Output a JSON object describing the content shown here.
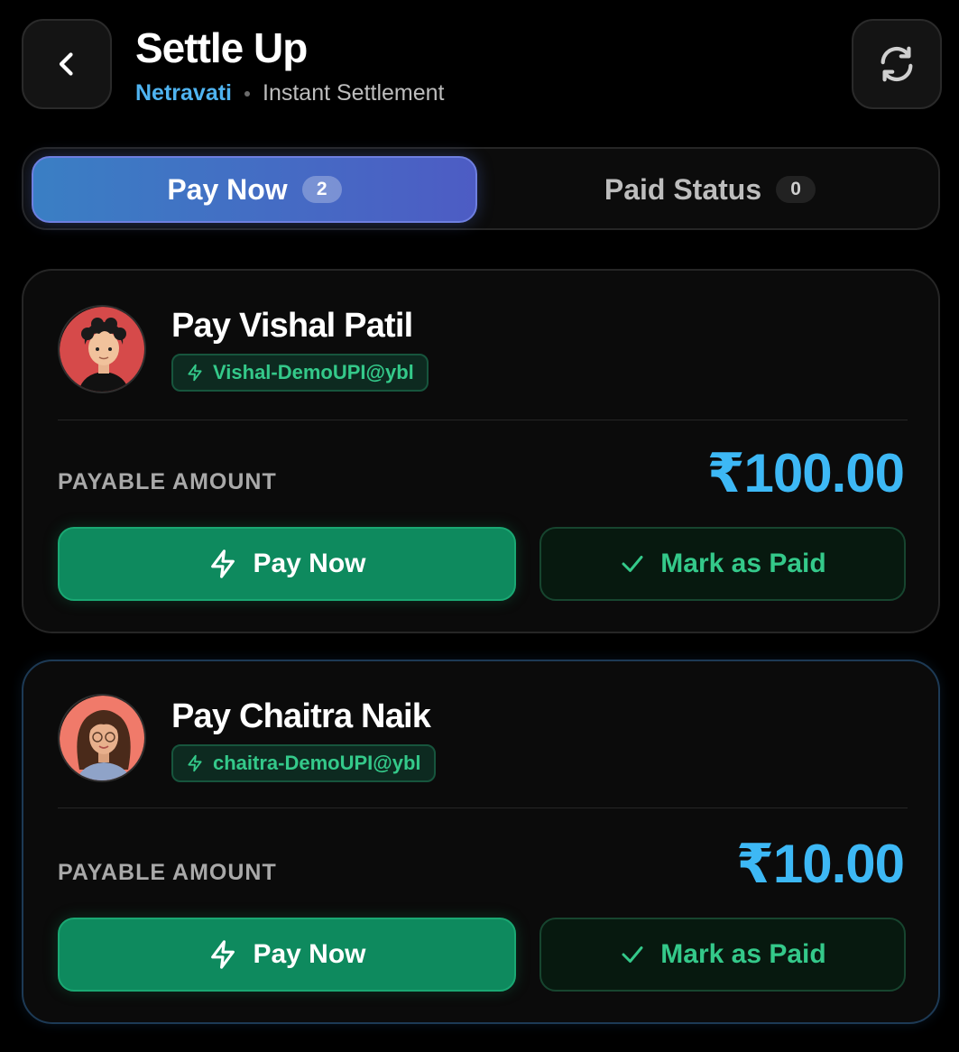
{
  "header": {
    "title": "Settle Up",
    "group_name": "Netravati",
    "settlement_type": "Instant Settlement",
    "back_icon": "chevron-left-icon",
    "refresh_icon": "refresh-icon"
  },
  "tabs": [
    {
      "label": "Pay Now",
      "count": "2",
      "active": true
    },
    {
      "label": "Paid Status",
      "count": "0",
      "active": false
    }
  ],
  "payments": [
    {
      "name": "Pay Vishal Patil",
      "upi": "Vishal-DemoUPI@ybl",
      "amount_label": "PAYABLE AMOUNT",
      "amount": "₹100.00",
      "pay_label": "Pay Now",
      "mark_label": "Mark as Paid",
      "avatar_bg": "#d64a4a"
    },
    {
      "name": "Pay Chaitra Naik",
      "upi": "chaitra-DemoUPI@ybl",
      "amount_label": "PAYABLE AMOUNT",
      "amount": "₹10.00",
      "pay_label": "Pay Now",
      "mark_label": "Mark as Paid",
      "avatar_bg": "#f07a6a"
    }
  ],
  "colors": {
    "accent_blue": "#3db8f5",
    "accent_green": "#34c98a",
    "pay_button": "#0e8a5e",
    "background": "#000000"
  }
}
